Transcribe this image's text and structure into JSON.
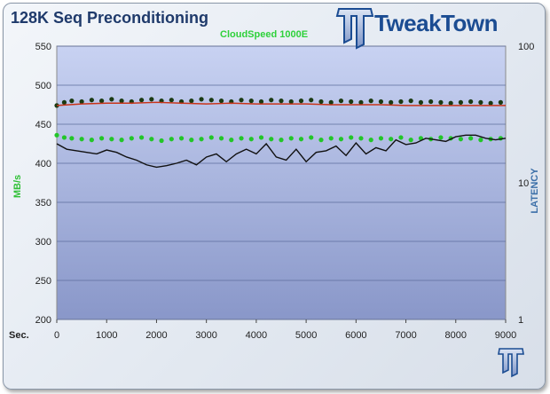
{
  "brand": {
    "name": "TweakTown"
  },
  "chart_data": {
    "type": "scatter",
    "title": "128K Seq Preconditioning",
    "subtitle": "CloudSpeed 1000E",
    "xlabel": "Sec.",
    "ylabel": "MB/s",
    "y2label": "LATENCY",
    "xlim": [
      0,
      9000
    ],
    "ylim": [
      200,
      550
    ],
    "y2lim": [
      1,
      100
    ],
    "y2scale": "log",
    "xticks": [
      "0",
      "1000",
      "2000",
      "3000",
      "4000",
      "5000",
      "6000",
      "7000",
      "8000",
      "9000"
    ],
    "yticks": [
      "200",
      "250",
      "300",
      "350",
      "400",
      "450",
      "500",
      "550"
    ],
    "y2ticks": [
      "1",
      "10",
      "100"
    ],
    "grid": true,
    "legend": "none",
    "series": [
      {
        "color": "#22c628",
        "marker": "point",
        "x": [
          0,
          150,
          300,
          500,
          700,
          900,
          1100,
          1300,
          1500,
          1700,
          1900,
          2100,
          2300,
          2500,
          2700,
          2900,
          3100,
          3300,
          3500,
          3700,
          3900,
          4100,
          4300,
          4500,
          4700,
          4900,
          5100,
          5300,
          5500,
          5700,
          5900,
          6100,
          6300,
          6500,
          6700,
          6900,
          7100,
          7300,
          7500,
          7700,
          7900,
          8100,
          8300,
          8500,
          8700,
          8900
        ],
        "values": [
          436,
          433,
          432,
          431,
          430,
          432,
          431,
          430,
          432,
          433,
          431,
          429,
          431,
          432,
          430,
          431,
          433,
          432,
          430,
          432,
          431,
          433,
          431,
          430,
          432,
          431,
          433,
          430,
          432,
          431,
          433,
          432,
          430,
          432,
          431,
          433,
          430,
          432,
          431,
          433,
          432,
          431,
          432,
          430,
          431,
          432
        ]
      },
      {
        "color": "#1a3a12",
        "marker": "point",
        "x": [
          0,
          150,
          300,
          500,
          700,
          900,
          1100,
          1300,
          1500,
          1700,
          1900,
          2100,
          2300,
          2500,
          2700,
          2900,
          3100,
          3300,
          3500,
          3700,
          3900,
          4100,
          4300,
          4500,
          4700,
          4900,
          5100,
          5300,
          5500,
          5700,
          5900,
          6100,
          6300,
          6500,
          6700,
          6900,
          7100,
          7300,
          7500,
          7700,
          7900,
          8100,
          8300,
          8500,
          8700,
          8900
        ],
        "values": [
          474,
          478,
          480,
          479,
          481,
          480,
          482,
          480,
          479,
          481,
          482,
          480,
          481,
          479,
          480,
          482,
          481,
          480,
          479,
          481,
          480,
          479,
          481,
          480,
          479,
          480,
          481,
          479,
          478,
          480,
          479,
          478,
          480,
          479,
          478,
          479,
          480,
          478,
          479,
          478,
          477,
          478,
          479,
          478,
          477,
          478
        ]
      },
      {
        "color": "#c8341a",
        "marker": "line",
        "x": [
          0,
          500,
          1000,
          1500,
          2000,
          2500,
          3000,
          3500,
          4000,
          4500,
          5000,
          5500,
          6000,
          6500,
          7000,
          7500,
          8000,
          8500,
          9000
        ],
        "values": [
          474,
          476,
          477,
          477,
          478,
          477,
          476,
          477,
          476,
          476,
          476,
          475,
          475,
          475,
          474,
          474,
          474,
          474,
          474
        ]
      },
      {
        "color": "#111111",
        "marker": "line",
        "x": [
          0,
          200,
          400,
          600,
          800,
          1000,
          1200,
          1400,
          1600,
          1800,
          2000,
          2200,
          2400,
          2600,
          2800,
          3000,
          3200,
          3400,
          3600,
          3800,
          4000,
          4200,
          4400,
          4600,
          4800,
          5000,
          5200,
          5400,
          5600,
          5800,
          6000,
          6200,
          6400,
          6600,
          6800,
          7000,
          7200,
          7400,
          7600,
          7800,
          8000,
          8200,
          8400,
          8600,
          8800,
          9000
        ],
        "values": [
          425,
          418,
          416,
          414,
          412,
          417,
          414,
          408,
          404,
          398,
          395,
          397,
          400,
          404,
          398,
          408,
          412,
          402,
          412,
          418,
          412,
          425,
          408,
          404,
          418,
          402,
          414,
          416,
          422,
          410,
          426,
          412,
          420,
          416,
          430,
          424,
          426,
          432,
          430,
          428,
          434,
          436,
          436,
          432,
          430,
          432
        ]
      }
    ]
  }
}
